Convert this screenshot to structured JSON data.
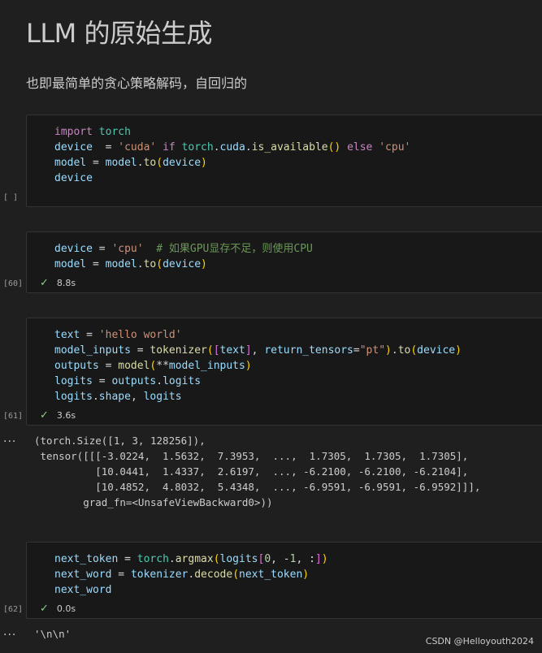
{
  "markdown": {
    "title": "LLM 的原始生成",
    "subtitle": "也即最简单的贪心策略解码，自回归的"
  },
  "cells": [
    {
      "exec_count": "[ ]",
      "lines": [
        [
          {
            "t": "import",
            "c": "kw"
          },
          {
            "t": " "
          },
          {
            "t": "torch",
            "c": "mod"
          }
        ],
        [
          {
            "t": "device",
            "c": "var"
          },
          {
            "t": "  = ",
            "c": "op"
          },
          {
            "t": "'cuda'",
            "c": "str"
          },
          {
            "t": " if ",
            "c": "kw"
          },
          {
            "t": "torch",
            "c": "mod"
          },
          {
            "t": ".",
            "c": "op"
          },
          {
            "t": "cuda",
            "c": "var"
          },
          {
            "t": ".",
            "c": "op"
          },
          {
            "t": "is_available",
            "c": "fn"
          },
          {
            "t": "()",
            "c": "p1"
          },
          {
            "t": " else ",
            "c": "kw"
          },
          {
            "t": "'cpu'",
            "c": "str"
          }
        ],
        [
          {
            "t": "model",
            "c": "var"
          },
          {
            "t": " = ",
            "c": "op"
          },
          {
            "t": "model",
            "c": "var"
          },
          {
            "t": ".",
            "c": "op"
          },
          {
            "t": "to",
            "c": "fn"
          },
          {
            "t": "(",
            "c": "p1"
          },
          {
            "t": "device",
            "c": "var"
          },
          {
            "t": ")",
            "c": "p1"
          }
        ],
        [
          {
            "t": "device",
            "c": "var"
          }
        ]
      ]
    },
    {
      "exec_count": "[60]",
      "duration": "8.8s",
      "lines": [
        [
          {
            "t": "device",
            "c": "var"
          },
          {
            "t": " = ",
            "c": "op"
          },
          {
            "t": "'cpu'",
            "c": "str"
          },
          {
            "t": "  "
          },
          {
            "t": "# 如果GPU显存不足，则使用CPU",
            "c": "cmt"
          }
        ],
        [
          {
            "t": "model",
            "c": "var"
          },
          {
            "t": " = ",
            "c": "op"
          },
          {
            "t": "model",
            "c": "var"
          },
          {
            "t": ".",
            "c": "op"
          },
          {
            "t": "to",
            "c": "fn"
          },
          {
            "t": "(",
            "c": "p1"
          },
          {
            "t": "device",
            "c": "var"
          },
          {
            "t": ")",
            "c": "p1"
          }
        ]
      ]
    },
    {
      "exec_count": "[61]",
      "duration": "3.6s",
      "lines": [
        [
          {
            "t": "text",
            "c": "var"
          },
          {
            "t": " = ",
            "c": "op"
          },
          {
            "t": "'hello world'",
            "c": "str"
          }
        ],
        [
          {
            "t": "model_inputs",
            "c": "var"
          },
          {
            "t": " = ",
            "c": "op"
          },
          {
            "t": "tokenizer",
            "c": "fn"
          },
          {
            "t": "(",
            "c": "p1"
          },
          {
            "t": "[",
            "c": "p2"
          },
          {
            "t": "text",
            "c": "var"
          },
          {
            "t": "]",
            "c": "p2"
          },
          {
            "t": ", ",
            "c": "op"
          },
          {
            "t": "return_tensors",
            "c": "var"
          },
          {
            "t": "=",
            "c": "op"
          },
          {
            "t": "\"pt\"",
            "c": "str"
          },
          {
            "t": ")",
            "c": "p1"
          },
          {
            "t": ".",
            "c": "op"
          },
          {
            "t": "to",
            "c": "fn"
          },
          {
            "t": "(",
            "c": "p1"
          },
          {
            "t": "device",
            "c": "var"
          },
          {
            "t": ")",
            "c": "p1"
          }
        ],
        [
          {
            "t": "outputs",
            "c": "var"
          },
          {
            "t": " = ",
            "c": "op"
          },
          {
            "t": "model",
            "c": "fn"
          },
          {
            "t": "(",
            "c": "p1"
          },
          {
            "t": "**",
            "c": "op"
          },
          {
            "t": "model_inputs",
            "c": "var"
          },
          {
            "t": ")",
            "c": "p1"
          }
        ],
        [
          {
            "t": "logits",
            "c": "var"
          },
          {
            "t": " = ",
            "c": "op"
          },
          {
            "t": "outputs",
            "c": "var"
          },
          {
            "t": ".",
            "c": "op"
          },
          {
            "t": "logits",
            "c": "var"
          }
        ],
        [
          {
            "t": "logits",
            "c": "var"
          },
          {
            "t": ".",
            "c": "op"
          },
          {
            "t": "shape",
            "c": "var"
          },
          {
            "t": ", ",
            "c": "op"
          },
          {
            "t": "logits",
            "c": "var"
          }
        ]
      ],
      "output": "(torch.Size([1, 3, 128256]),\n tensor([[[-3.0224,  1.5632,  7.3953,  ...,  1.7305,  1.7305,  1.7305],\n          [10.0441,  1.4337,  2.6197,  ..., -6.2100, -6.2100, -6.2104],\n          [10.4852,  4.8032,  5.4348,  ..., -6.9591, -6.9591, -6.9592]]],\n        grad_fn=<UnsafeViewBackward0>))"
    },
    {
      "exec_count": "[62]",
      "duration": "0.0s",
      "lines": [
        [
          {
            "t": "next_token",
            "c": "var"
          },
          {
            "t": " = ",
            "c": "op"
          },
          {
            "t": "torch",
            "c": "mod"
          },
          {
            "t": ".",
            "c": "op"
          },
          {
            "t": "argmax",
            "c": "fn"
          },
          {
            "t": "(",
            "c": "p1"
          },
          {
            "t": "logits",
            "c": "var"
          },
          {
            "t": "[",
            "c": "p2"
          },
          {
            "t": "0",
            "c": "num"
          },
          {
            "t": ", -",
            "c": "op"
          },
          {
            "t": "1",
            "c": "num"
          },
          {
            "t": ", :",
            "c": "op"
          },
          {
            "t": "]",
            "c": "p2"
          },
          {
            "t": ")",
            "c": "p1"
          }
        ],
        [
          {
            "t": "next_word",
            "c": "var"
          },
          {
            "t": " = ",
            "c": "op"
          },
          {
            "t": "tokenizer",
            "c": "var"
          },
          {
            "t": ".",
            "c": "op"
          },
          {
            "t": "decode",
            "c": "fn"
          },
          {
            "t": "(",
            "c": "p1"
          },
          {
            "t": "next_token",
            "c": "var"
          },
          {
            "t": ")",
            "c": "p1"
          }
        ],
        [
          {
            "t": "next_word",
            "c": "var"
          }
        ]
      ],
      "output": "'\\n\\n'"
    }
  ],
  "output_ellipsis": "...",
  "check_icon": "check-icon",
  "watermark": "CSDN @Helloyouth2024"
}
